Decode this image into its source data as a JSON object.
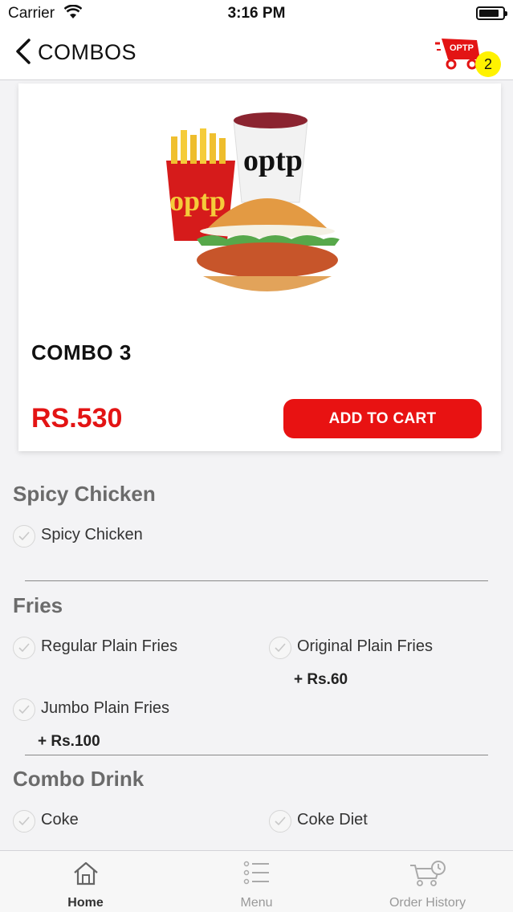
{
  "status": {
    "carrier": "Carrier",
    "time": "3:16 PM"
  },
  "nav": {
    "title": "COMBOS",
    "cart_count": "2",
    "cart_brand": "OPTP"
  },
  "product": {
    "name": "COMBO 3",
    "price": "RS.530",
    "add_label": "ADD TO CART"
  },
  "groups": {
    "main": {
      "title": "Spicy Chicken",
      "options": [
        "Spicy Chicken"
      ]
    },
    "fries": {
      "title": "Fries",
      "options": [
        "Regular Plain Fries",
        "Original Plain Fries",
        "Jumbo Plain Fries"
      ],
      "extras": [
        "+ Rs.60",
        "+ Rs.100"
      ]
    },
    "drink": {
      "title": "Combo Drink",
      "options": [
        "Coke",
        "Coke Diet"
      ]
    }
  },
  "tabs": [
    "Home",
    "Menu",
    "Order History"
  ],
  "colors": {
    "accent": "#e81212",
    "badge": "#fff200"
  }
}
